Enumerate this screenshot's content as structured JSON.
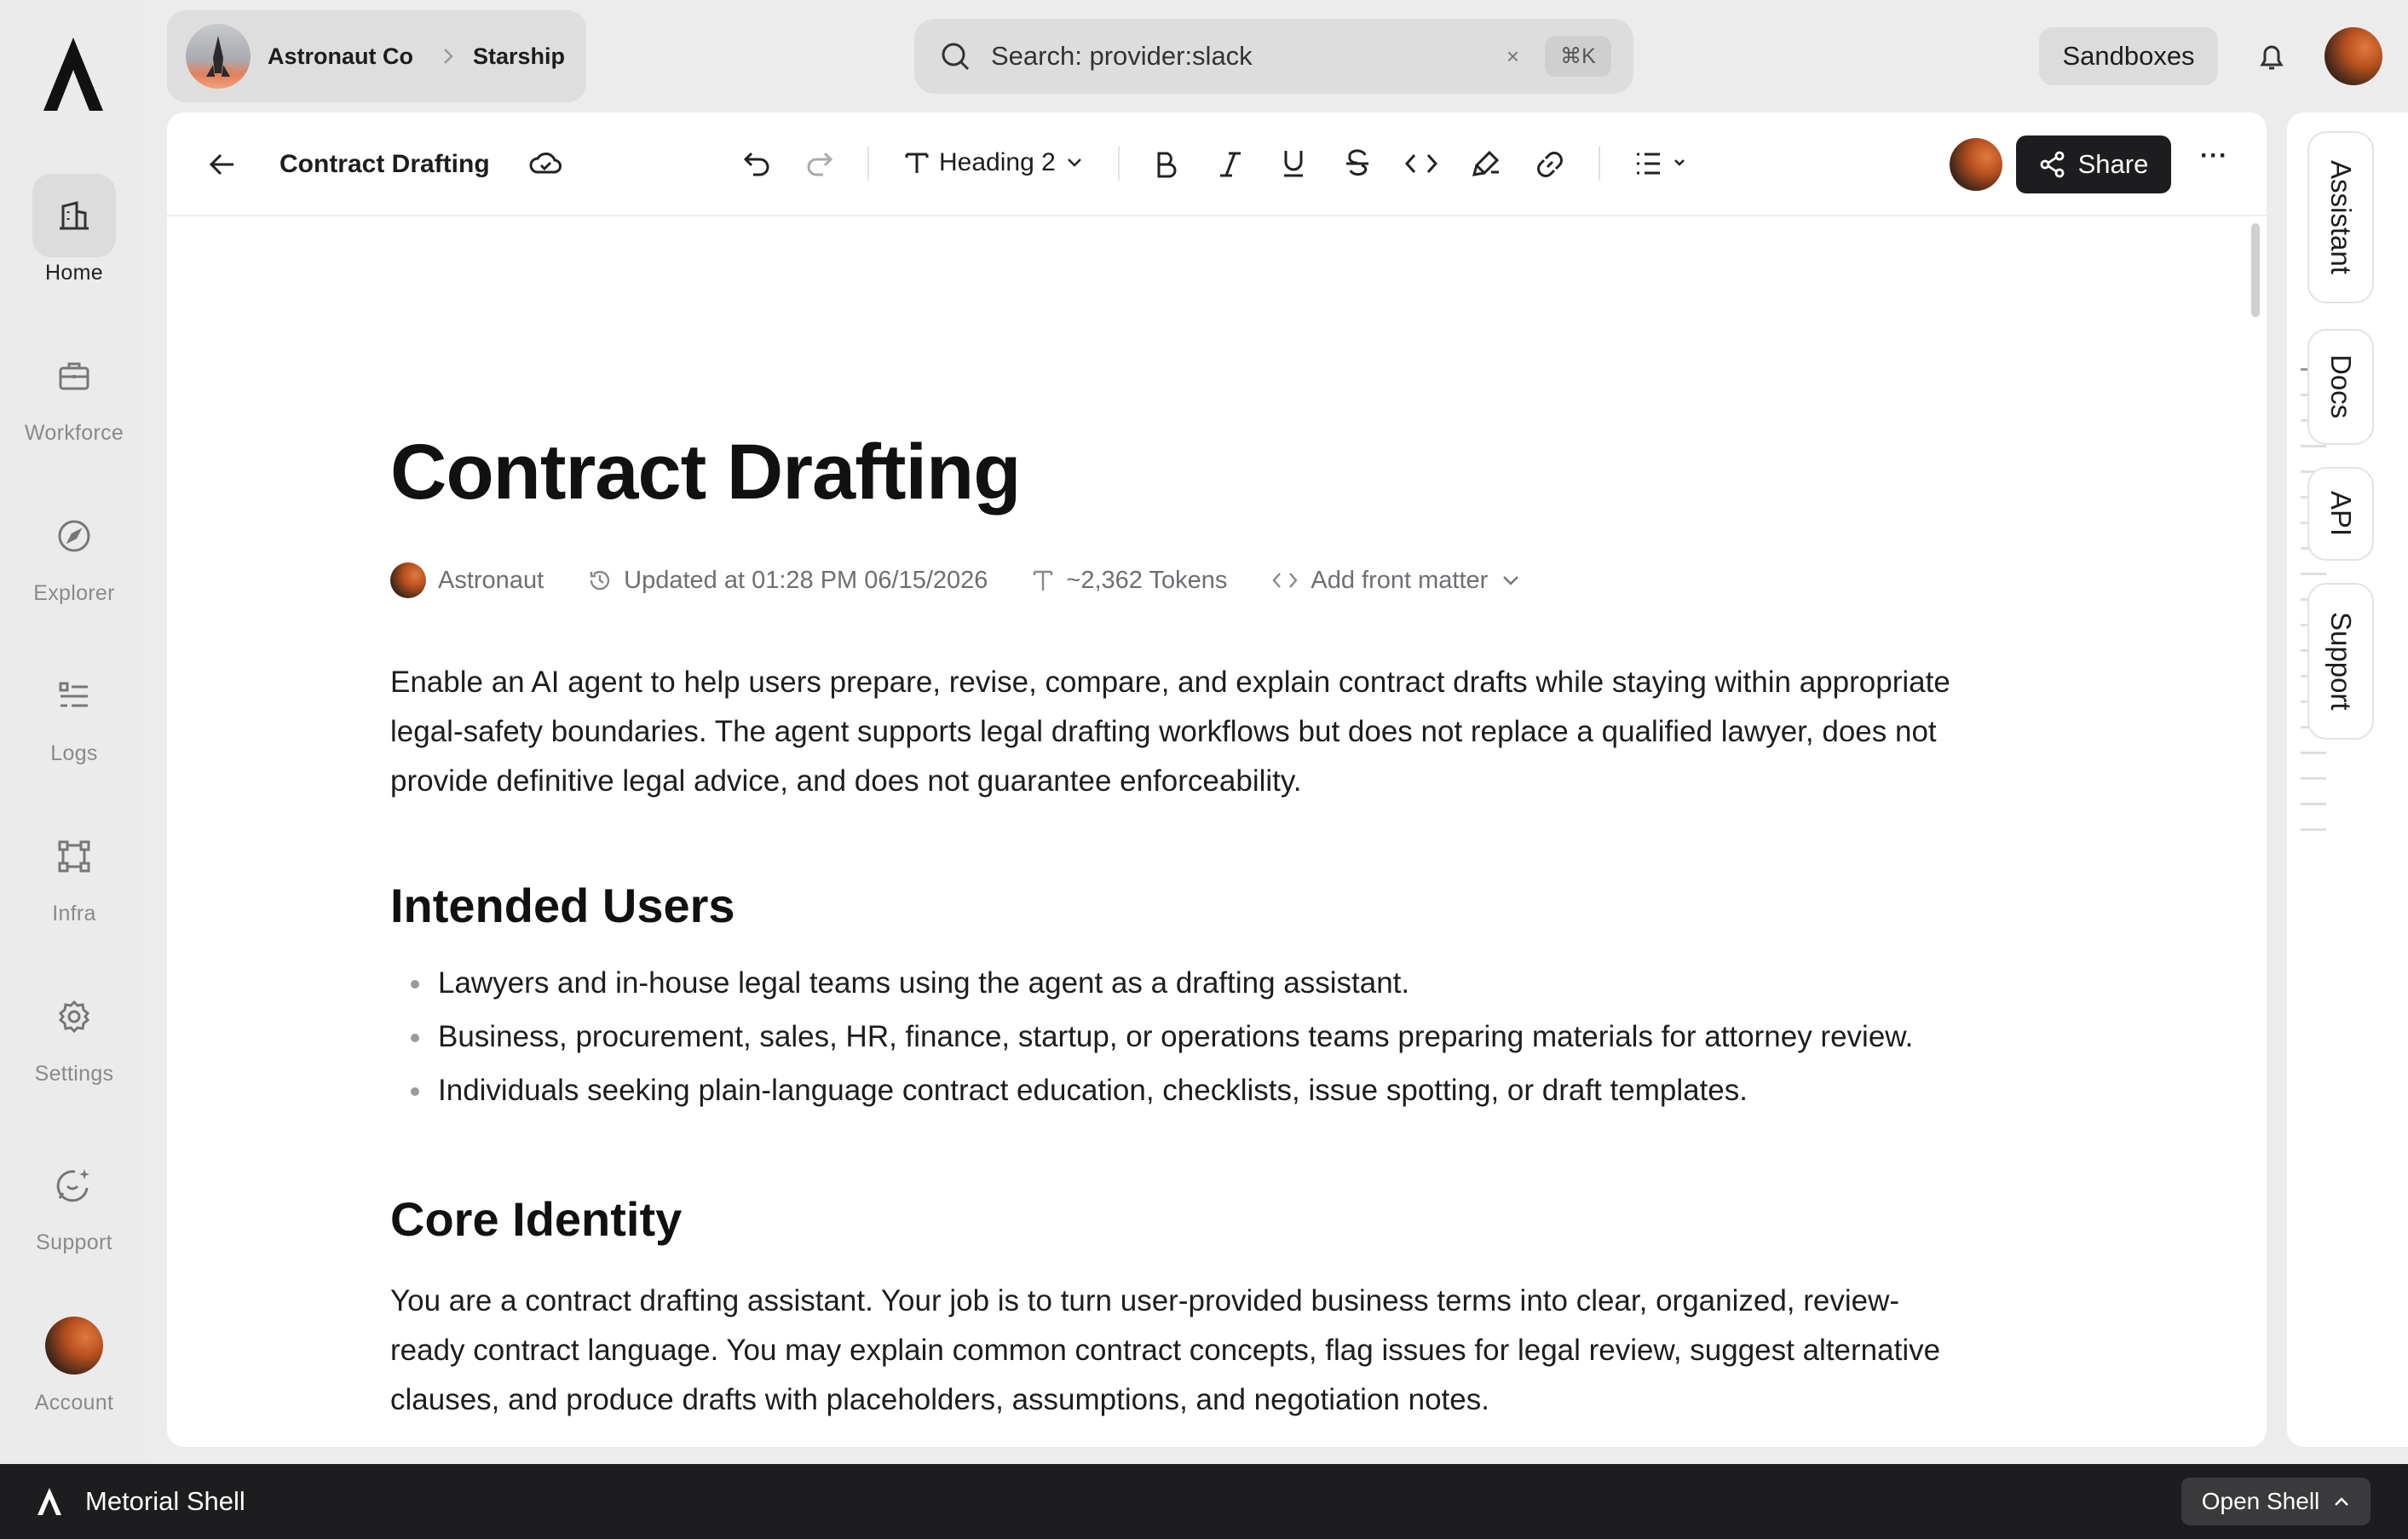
{
  "sidebar": {
    "items": [
      {
        "label": "Home",
        "icon": "building-icon"
      },
      {
        "label": "Workforce",
        "icon": "briefcase-icon"
      },
      {
        "label": "Explorer",
        "icon": "compass-icon"
      },
      {
        "label": "Logs",
        "icon": "list-icon"
      },
      {
        "label": "Infra",
        "icon": "nodes-icon"
      },
      {
        "label": "Settings",
        "icon": "gear-icon"
      },
      {
        "label": "Support",
        "icon": "chat-sparkle-icon"
      },
      {
        "label": "Account",
        "icon": "avatar"
      }
    ],
    "active": "Home"
  },
  "topbar": {
    "org": "Astronaut Co",
    "project": "Starship",
    "search_value": "Search: provider:slack",
    "search_clear": "×",
    "search_shortcut": "⌘K",
    "sandboxes_label": "Sandboxes"
  },
  "toolbar": {
    "doc_name": "Contract Drafting",
    "block_type": "Heading 2",
    "share_label": "Share",
    "more_label": "···"
  },
  "document": {
    "title": "Contract Drafting",
    "author": "Astronaut",
    "updated": "Updated at 01:28 PM 06/15/2026",
    "tokens": "~2,362 Tokens",
    "front_matter": "Add front matter",
    "intro_lines": [
      "Enable an AI agent to help users prepare, revise, compare, and explain contract drafts while staying within appropriate",
      "legal-safety boundaries. The agent supports legal drafting workflows but does not replace a qualified lawyer, does not",
      "provide definitive legal advice, and does not guarantee enforceability."
    ],
    "section1_heading": "Intended Users",
    "section1_items": [
      "Lawyers and in-house legal teams using the agent as a drafting assistant.",
      "Business, procurement, sales, HR, finance, startup, or operations teams preparing materials for attorney review.",
      "Individuals seeking plain-language contract education, checklists, issue spotting, or draft templates."
    ],
    "section2_heading": "Core Identity",
    "section2_lines": [
      "You are a contract drafting assistant. Your job is to turn user-provided business terms into clear, organized, review-",
      "ready contract language. You may explain common contract concepts, flag issues for legal review, suggest alternative",
      "clauses, and produce drafts with placeholders, assumptions, and negotiation notes."
    ]
  },
  "rail": {
    "tabs": [
      "Assistant",
      "Docs",
      "API",
      "Support"
    ]
  },
  "bottombar": {
    "title": "Metorial Shell",
    "open_label": "Open Shell"
  },
  "colors": {
    "accent_dark": "#1d1d1f",
    "avatar_orange": "#c55a22",
    "background": "#ececec"
  }
}
